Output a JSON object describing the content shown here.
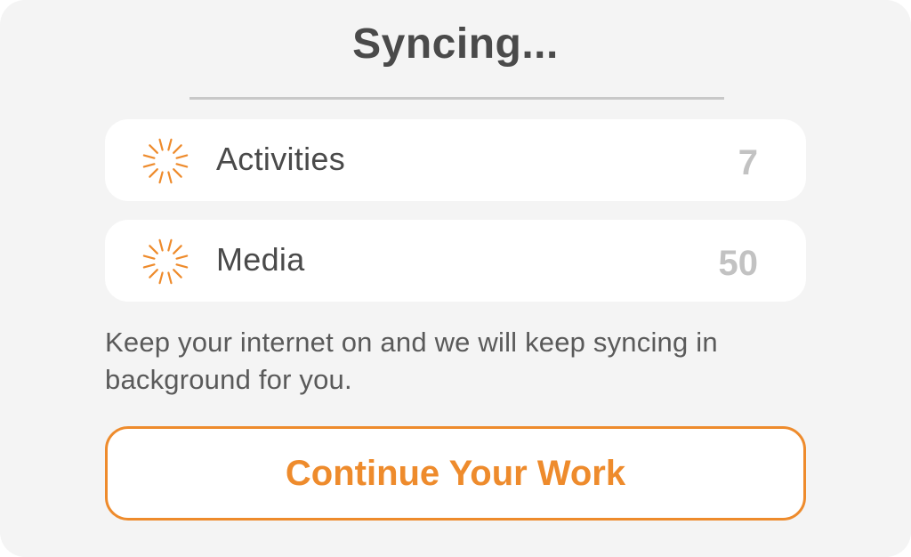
{
  "dialog": {
    "title": "Syncing...",
    "items": [
      {
        "label": "Activities",
        "count": "7",
        "icon": "loading-spinner-icon"
      },
      {
        "label": "Media",
        "count": "50",
        "icon": "loading-spinner-icon"
      }
    ],
    "message": "Keep your internet on and we will keep syncing in background for you.",
    "button_label": "Continue Your Work"
  },
  "colors": {
    "accent": "#ee8b2c",
    "background": "#f4f4f4",
    "card": "#ffffff",
    "text": "#4a4a4a",
    "count": "#c2c2c2"
  }
}
